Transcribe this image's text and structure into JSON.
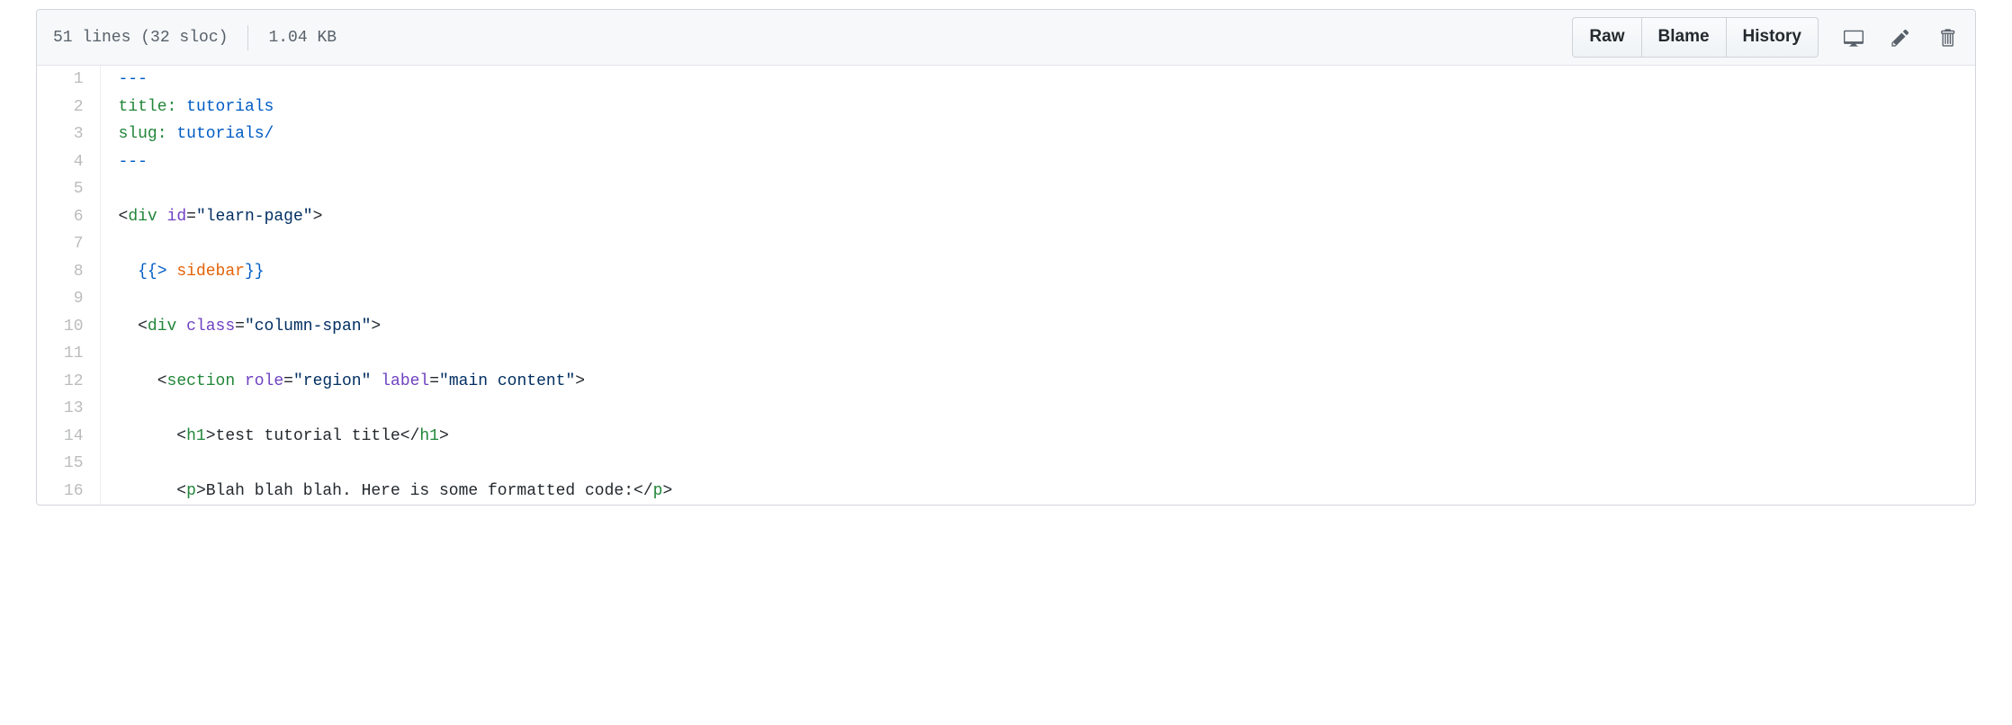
{
  "header": {
    "line_info": "51 lines (32 sloc)",
    "file_size": "1.04 KB",
    "actions": {
      "raw": "Raw",
      "blame": "Blame",
      "history": "History"
    }
  },
  "code": {
    "lines": [
      {
        "n": "1",
        "html": "<span class=\"pl-c1\">---</span>"
      },
      {
        "n": "2",
        "html": "<span class=\"pl-ent\">title</span><span class=\"pl-ent\">:</span> <span class=\"pl-c1\">tutorials</span>"
      },
      {
        "n": "3",
        "html": "<span class=\"pl-ent\">slug</span><span class=\"pl-ent\">:</span> <span class=\"pl-c1\">tutorials/</span>"
      },
      {
        "n": "4",
        "html": "<span class=\"pl-c1\">---</span>"
      },
      {
        "n": "5",
        "html": ""
      },
      {
        "n": "6",
        "html": "&lt;<span class=\"pl-ent\">div</span> <span class=\"pl-e\">id</span>=<span class=\"pl-s\">\"learn-page\"</span>&gt;"
      },
      {
        "n": "7",
        "html": ""
      },
      {
        "n": "8",
        "html": "  <span class=\"pl-c1\">{{</span><span class=\"pl-c1\">&gt;</span> <span class=\"pl-orange\">sidebar</span><span class=\"pl-c1\">}}</span>"
      },
      {
        "n": "9",
        "html": ""
      },
      {
        "n": "10",
        "html": "  &lt;<span class=\"pl-ent\">div</span> <span class=\"pl-e\">class</span>=<span class=\"pl-s\">\"column-span\"</span>&gt;"
      },
      {
        "n": "11",
        "html": ""
      },
      {
        "n": "12",
        "html": "    &lt;<span class=\"pl-ent\">section</span> <span class=\"pl-e\">role</span>=<span class=\"pl-s\">\"region\"</span> <span class=\"pl-e\">label</span>=<span class=\"pl-s\">\"main content\"</span>&gt;"
      },
      {
        "n": "13",
        "html": ""
      },
      {
        "n": "14",
        "html": "      &lt;<span class=\"pl-ent\">h1</span>&gt;test tutorial title&lt;/<span class=\"pl-ent\">h1</span>&gt;"
      },
      {
        "n": "15",
        "html": ""
      },
      {
        "n": "16",
        "html": "      &lt;<span class=\"pl-ent\">p</span>&gt;Blah blah blah. Here is some formatted code:&lt;/<span class=\"pl-ent\">p</span>&gt;"
      }
    ]
  }
}
